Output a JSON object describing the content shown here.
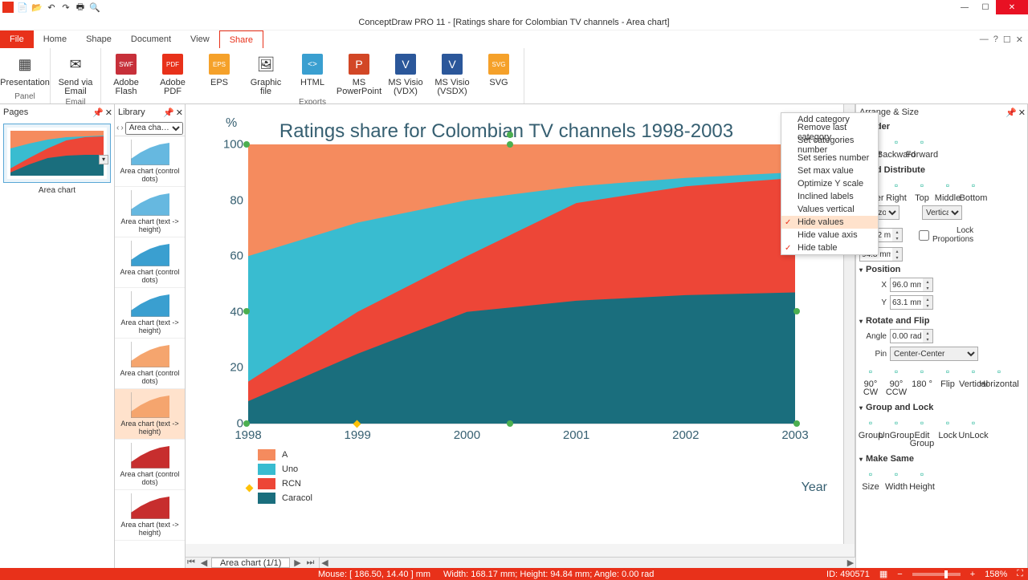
{
  "app_title": "ConceptDraw PRO 11 - [Ratings share for Colombian TV channels - Area chart]",
  "qat": [
    "app",
    "new",
    "open",
    "undo",
    "redo",
    "print",
    "find"
  ],
  "tabs": {
    "file": "File",
    "home": "Home",
    "shape": "Shape",
    "document": "Document",
    "view": "View",
    "share": "Share"
  },
  "ribbon": {
    "groups": [
      {
        "label": "Panel",
        "items": [
          {
            "label": "Presentation",
            "icon": "▦"
          }
        ]
      },
      {
        "label": "Email",
        "items": [
          {
            "label": "Send via Email",
            "icon": "✉"
          }
        ]
      },
      {
        "label": "Exports",
        "items": [
          {
            "label": "Adobe Flash",
            "icon": "SWF"
          },
          {
            "label": "Adobe PDF",
            "icon": "PDF"
          },
          {
            "label": "EPS",
            "icon": "EPS"
          },
          {
            "label": "Graphic file",
            "icon": "🖼"
          },
          {
            "label": "HTML",
            "icon": "< >"
          },
          {
            "label": "MS PowerPoint",
            "icon": "P"
          },
          {
            "label": "MS Visio (VDX)",
            "icon": "V"
          },
          {
            "label": "MS Visio (VSDX)",
            "icon": "V"
          },
          {
            "label": "SVG",
            "icon": "SVG"
          }
        ]
      }
    ]
  },
  "pages_panel": {
    "title": "Pages",
    "thumb_label": "Area chart"
  },
  "library_panel": {
    "title": "Library",
    "dropdown": "Area cha…",
    "items": [
      {
        "label": "Area chart (control dots)",
        "color": "#66b8e0"
      },
      {
        "label": "Area chart (text -> height)",
        "color": "#66b8e0"
      },
      {
        "label": "Area chart (control dots)",
        "color": "#3a9fd0"
      },
      {
        "label": "Area chart (text -> height)",
        "color": "#3a9fd0"
      },
      {
        "label": "Area chart (control dots)",
        "color": "#f5a56e"
      },
      {
        "label": "Area chart (text -> height)",
        "color": "#f5a56e",
        "sel": true
      },
      {
        "label": "Area chart (control dots)",
        "color": "#c72e2e"
      },
      {
        "label": "Area chart (text -> height)",
        "color": "#c72e2e"
      }
    ]
  },
  "context_menu": [
    {
      "label": "Add category"
    },
    {
      "label": "Remove last category"
    },
    {
      "label": "Set categories number"
    },
    {
      "label": "Set series number"
    },
    {
      "label": "Set max value"
    },
    {
      "label": "Optimize Y scale"
    },
    {
      "label": "Inclined labels"
    },
    {
      "label": "Values vertical",
      "disabled": true
    },
    {
      "label": "Hide values",
      "checked": true,
      "hover": true
    },
    {
      "label": "Hide value axis"
    },
    {
      "label": "Hide table",
      "checked": true
    }
  ],
  "arrange": {
    "title": "Arrange & Size",
    "order": {
      "title": "Order",
      "items": [
        "Front",
        "Backward",
        "Forward"
      ]
    },
    "align": {
      "title": "and Distribute",
      "items": [
        "Center",
        "Right",
        "Top",
        "Middle",
        "Bottom"
      ],
      "hopt": "Horizontal",
      "vopt": "Vertical"
    },
    "size": {
      "w": "168.2 mm",
      "h": "94.8 mm",
      "lock": "Lock Proportions"
    },
    "position": {
      "title": "Position",
      "x": "96.0 mm",
      "y": "63.1 mm"
    },
    "rotate": {
      "title": "Rotate and Flip",
      "angle": "0.00 rad",
      "pin": "Center-Center",
      "items": [
        "90° CW",
        "90° CCW",
        "180 °",
        "Flip",
        "Vertical",
        "Horizontal"
      ]
    },
    "group": {
      "title": "Group and Lock",
      "items": [
        "Group",
        "UnGroup",
        "Edit Group",
        "Lock",
        "UnLock"
      ]
    },
    "makesame": {
      "title": "Make Same",
      "items": [
        "Size",
        "Width",
        "Height"
      ]
    }
  },
  "chart_data": {
    "type": "area",
    "title": "Ratings share for Colombian TV channels 1998-2003",
    "yunit": "%",
    "xlabel": "Year",
    "ylim": [
      0,
      100
    ],
    "categories": [
      "1998",
      "1999",
      "2000",
      "2001",
      "2002",
      "2003"
    ],
    "series": [
      {
        "name": "Caracol",
        "color": "#1a6e7d",
        "values": [
          8,
          25,
          40,
          44,
          46,
          47
        ]
      },
      {
        "name": "RCN",
        "color": "#ed4637",
        "values": [
          15,
          40,
          60,
          79,
          85,
          88
        ]
      },
      {
        "name": "Uno",
        "color": "#39bcd0",
        "values": [
          60,
          72,
          80,
          85,
          88,
          90
        ]
      },
      {
        "name": "A",
        "color": "#f58b5e",
        "values": [
          100,
          100,
          100,
          100,
          100,
          100
        ]
      }
    ],
    "legend_order": [
      "A",
      "Uno",
      "RCN",
      "Caracol"
    ],
    "yticks": [
      0,
      20,
      40,
      60,
      80,
      100
    ]
  },
  "page_tab": "Area chart (1/1)",
  "status": {
    "mouse": "Mouse: [ 186.50, 14.40 ] mm",
    "dims": "Width: 168.17 mm;  Height: 94.84 mm;  Angle: 0.00 rad",
    "id": "ID: 490571",
    "zoom": "158%"
  }
}
